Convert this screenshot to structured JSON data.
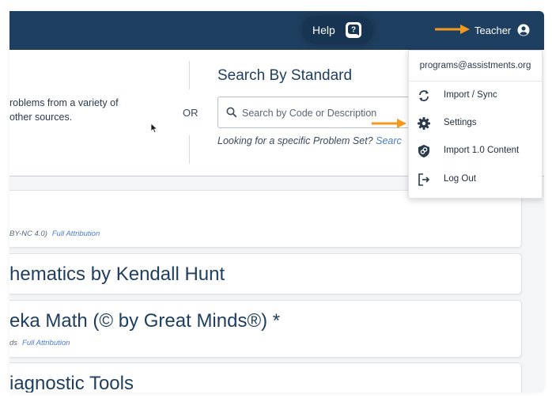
{
  "topbar": {
    "help_label": "Help",
    "user_label": "Teacher"
  },
  "search": {
    "problems_text_line1": "roblems from a variety of",
    "problems_text_line2": "other sources.",
    "or_label": "OR",
    "standard_title": "Search By Standard",
    "placeholder": "Search by Code or Description",
    "looking_text": "Looking for a specific Problem Set?",
    "looking_link": "Searc"
  },
  "cards": [
    {
      "title": "",
      "sub": "BY-NC 4.0)",
      "attr": "Full Attribution"
    },
    {
      "title": "hematics by Kendall Hunt",
      "sub": "",
      "attr": ""
    },
    {
      "title": "eka Math (© by Great Minds®) *",
      "sub": "ds",
      "attr": "Full Attribution"
    },
    {
      "title": "iagnostic Tools",
      "sub": "",
      "attr": ""
    }
  ],
  "menu": {
    "email": "programs@assistments.org",
    "items": [
      {
        "label": "Import / Sync",
        "icon": "sync-icon"
      },
      {
        "label": "Settings",
        "icon": "gear-icon"
      },
      {
        "label": "Import 1.0 Content",
        "icon": "shield-link-icon"
      },
      {
        "label": "Log Out",
        "icon": "logout-icon"
      }
    ]
  },
  "colors": {
    "header": "#1f3f60",
    "accent_arrow": "#f39a1e",
    "link": "#4a7bd0"
  }
}
